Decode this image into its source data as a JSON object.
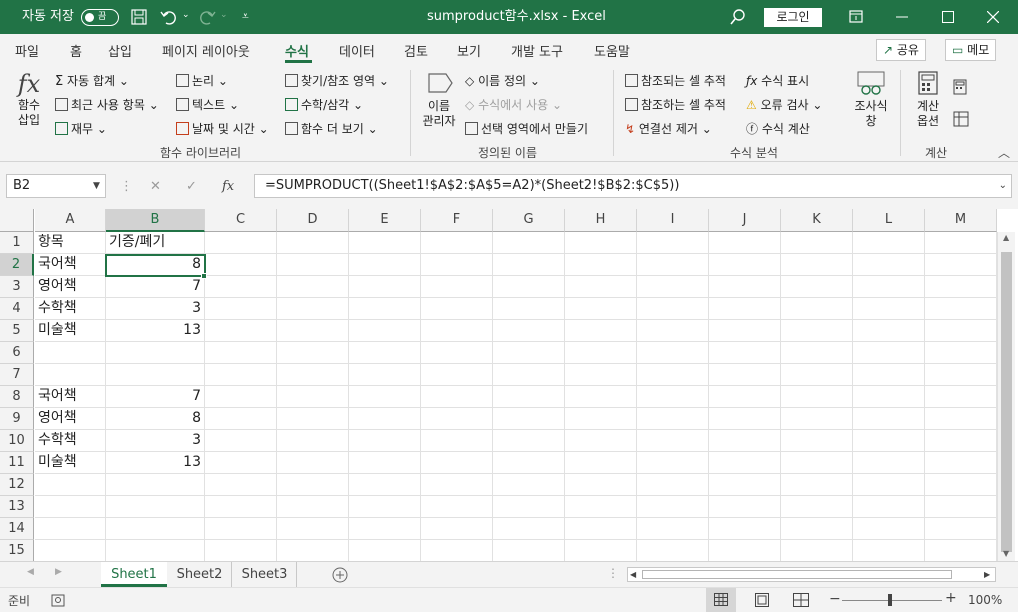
{
  "titlebar": {
    "autosave_label": "자동 저장",
    "autosave_state": "끔",
    "doc_title": "sumproduct함수.xlsx  -  Excel",
    "login_label": "로그인"
  },
  "menu": {
    "tabs": [
      "파일",
      "홈",
      "삽입",
      "페이지 레이아웃",
      "수식",
      "데이터",
      "검토",
      "보기",
      "개발 도구",
      "도움말"
    ],
    "active_tab": "수식",
    "share_label": "공유",
    "memo_label": "메모"
  },
  "ribbon": {
    "insert_fn": [
      "함수",
      "삽입"
    ],
    "library": {
      "autosum": "자동 합계",
      "recent": "최근 사용 항목",
      "financial": "재무",
      "logical": "논리",
      "text": "텍스트",
      "datetime": "날짜 및 시간",
      "lookup": "찾기/참조 영역",
      "math": "수학/삼각",
      "more": "함수 더 보기",
      "group_label": "함수 라이브러리"
    },
    "names": {
      "manager": [
        "이름",
        "관리자"
      ],
      "define": "이름 정의",
      "use_in_formula": "수식에서 사용",
      "create_from_selection": "선택 영역에서 만들기",
      "group_label": "정의된 이름"
    },
    "audit": {
      "trace_precedents": "참조되는 셀 추적",
      "trace_dependents": "참조하는 셀 추적",
      "remove_arrows": "연결선 제거",
      "show_formulas": "수식 표시",
      "error_check": "오류 검사",
      "evaluate": "수식 계산",
      "watch": [
        "조사식",
        "창"
      ],
      "group_label": "수식 분석"
    },
    "calc": {
      "options": [
        "계산",
        "옵션"
      ],
      "group_label": "계산"
    }
  },
  "formula_bar": {
    "name_box": "B2",
    "fx": "fx",
    "formula": "=SUMPRODUCT((Sheet1!$A$2:$A$5=A2)*(Sheet2!$B$2:$C$5))"
  },
  "sheet": {
    "columns": [
      "A",
      "B",
      "C",
      "D",
      "E",
      "F",
      "G",
      "H",
      "I",
      "J",
      "K",
      "L",
      "M"
    ],
    "rows": [
      "1",
      "2",
      "3",
      "4",
      "5",
      "6",
      "7",
      "8",
      "9",
      "10",
      "11",
      "12",
      "13",
      "14",
      "15"
    ],
    "cells": {
      "A1": "항목",
      "B1": "기증/폐기",
      "A2": "국어책",
      "B2": "8",
      "A3": "영어책",
      "B3": "7",
      "A4": "수학책",
      "B4": "3",
      "A5": "미술책",
      "B5": "13",
      "A8": "국어책",
      "B8": "7",
      "A9": "영어책",
      "B9": "8",
      "A10": "수학책",
      "B10": "3",
      "A11": "미술책",
      "B11": "13"
    },
    "selected": "B2"
  },
  "tabs": {
    "sheets": [
      "Sheet1",
      "Sheet2",
      "Sheet3"
    ],
    "active": "Sheet1"
  },
  "status": {
    "ready": "준비",
    "zoom": "100%"
  }
}
